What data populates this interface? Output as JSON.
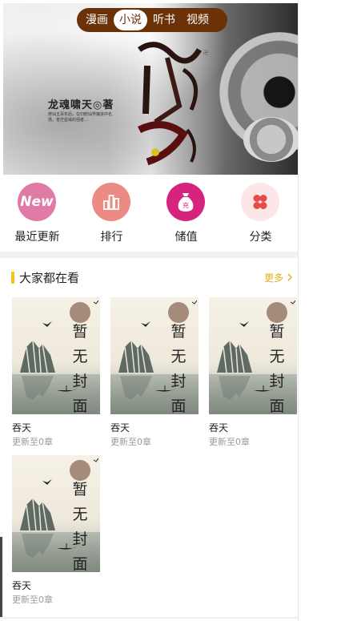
{
  "top_tabs": [
    {
      "label": "漫画"
    },
    {
      "label": "小说",
      "active": true
    },
    {
      "label": "听书"
    },
    {
      "label": "视频"
    }
  ],
  "banner": {
    "author": "龙魂啸天◎著",
    "blurb": "修仙五百年后，在归鹤仙界魔道中名扬，苍茫星域的强者…",
    "colors": {
      "tab_bg": "#6b3208"
    }
  },
  "quick_nav": [
    {
      "label": "最近更新",
      "icon": "new-icon",
      "icon_text": "New"
    },
    {
      "label": "排行",
      "icon": "ranking-icon"
    },
    {
      "label": "储值",
      "icon": "money-bag-icon",
      "icon_text": "充"
    },
    {
      "label": "分类",
      "icon": "category-icon"
    }
  ],
  "section": {
    "title": "大家都在看",
    "more": "更多"
  },
  "books": [
    {
      "name": "吞天",
      "update": "更新至0章",
      "cover_text": [
        "暂",
        "无",
        "封",
        "面"
      ]
    },
    {
      "name": "吞天",
      "update": "更新至0章",
      "cover_text": [
        "暂",
        "无",
        "封",
        "面"
      ]
    },
    {
      "name": "吞天",
      "update": "更新至0章",
      "cover_text": [
        "暂",
        "无",
        "封",
        "面"
      ]
    },
    {
      "name": "吞天",
      "update": "更新至0章",
      "cover_text": [
        "暂",
        "无",
        "封",
        "面"
      ]
    }
  ],
  "colors": {
    "accent_yellow": "#f4c21d",
    "more_color": "#e2b021",
    "tab_brown": "#6b3208"
  }
}
